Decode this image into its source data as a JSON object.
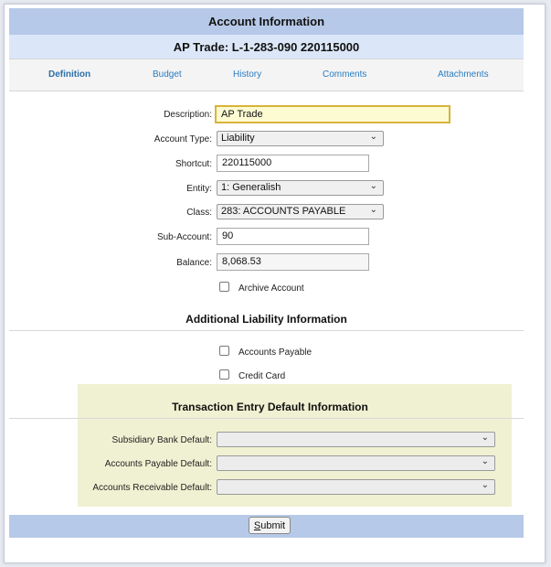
{
  "header": {
    "title": "Account Information",
    "account_line": "AP Trade: L-1-283-090 220115000"
  },
  "tabs": [
    {
      "label": "Definition",
      "active": true
    },
    {
      "label": "Budget"
    },
    {
      "label": "History"
    },
    {
      "label": "Comments"
    },
    {
      "label": "Attachments"
    }
  ],
  "form": {
    "description": {
      "label": "Description:",
      "value": "AP Trade"
    },
    "account_type": {
      "label": "Account Type:",
      "value": "Liability"
    },
    "shortcut": {
      "label": "Shortcut:",
      "value": "220115000"
    },
    "entity": {
      "label": "Entity:",
      "value": "1: Generalish"
    },
    "class": {
      "label": "Class:",
      "value": "283: ACCOUNTS PAYABLE"
    },
    "sub_account": {
      "label": "Sub-Account:",
      "value": "90"
    },
    "balance": {
      "label": "Balance:",
      "value": "8,068.53"
    },
    "archive": {
      "label": "Archive Account",
      "checked": false
    }
  },
  "liability": {
    "heading": "Additional Liability Information",
    "accounts_payable": {
      "label": "Accounts Payable",
      "checked": false
    },
    "credit_card": {
      "label": "Credit Card",
      "checked": false
    }
  },
  "transaction": {
    "heading": "Transaction Entry Default Information",
    "subsidiary_bank": {
      "label": "Subsidiary Bank Default:",
      "value": ""
    },
    "accounts_payable": {
      "label": "Accounts Payable Default:",
      "value": ""
    },
    "accounts_receivable": {
      "label": "Accounts Receivable Default:",
      "value": ""
    }
  },
  "footer": {
    "submit_underlined": "S",
    "submit_rest": "ubmit"
  },
  "colors": {
    "header_bar": "#b7c9e8",
    "subheader_bar": "#dbe7f8",
    "tab_link": "#2a7cc0",
    "panel_yellow": "#f0f1d2"
  }
}
